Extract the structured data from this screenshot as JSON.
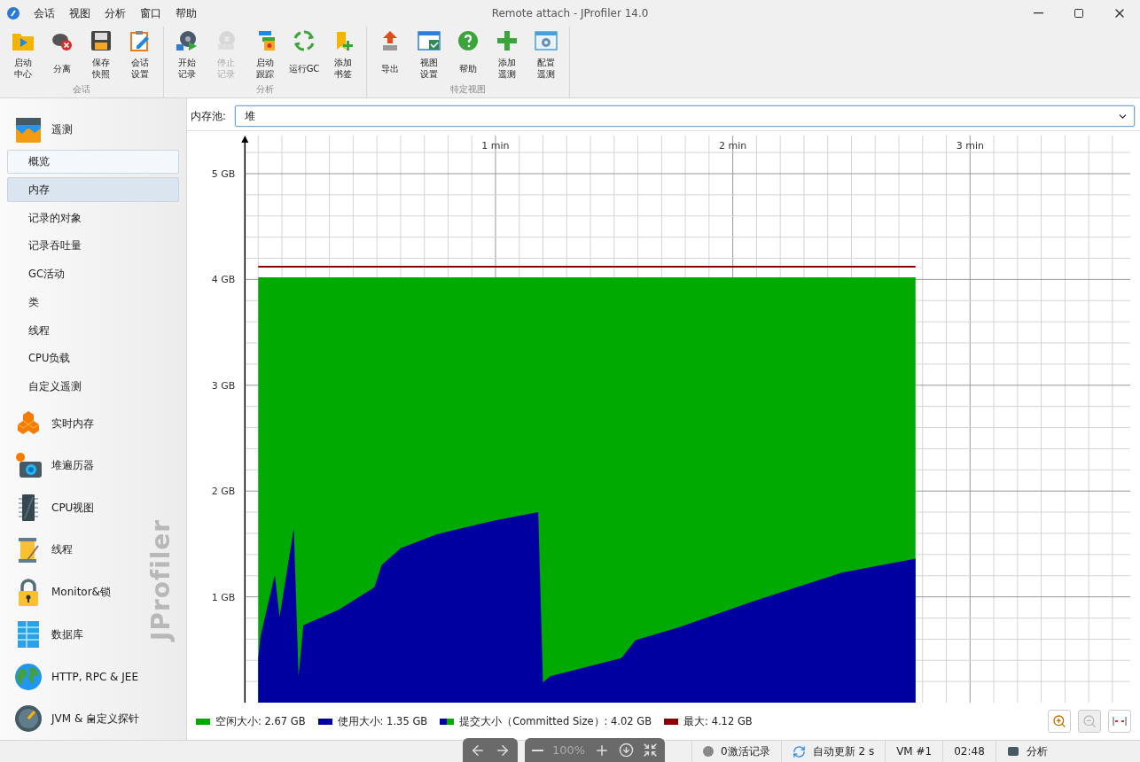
{
  "window": {
    "title": "Remote attach - JProfiler 14.0"
  },
  "menu": [
    "会话",
    "视图",
    "分析",
    "窗口",
    "帮助"
  ],
  "toolbar": {
    "groups": [
      {
        "label": "会话",
        "items": [
          {
            "lines": [
              "启动",
              "中心"
            ],
            "disabled": false
          },
          {
            "lines": [
              "分离"
            ],
            "disabled": false
          },
          {
            "lines": [
              "保存",
              "快照"
            ],
            "disabled": false
          },
          {
            "lines": [
              "会话",
              "设置"
            ],
            "disabled": false
          }
        ]
      },
      {
        "label": "分析",
        "items": [
          {
            "lines": [
              "开始",
              "记录"
            ],
            "disabled": false
          },
          {
            "lines": [
              "停止",
              "记录"
            ],
            "disabled": true
          },
          {
            "lines": [
              "启动",
              "跟踪"
            ],
            "disabled": false
          },
          {
            "lines": [
              "运行GC"
            ],
            "disabled": false
          },
          {
            "lines": [
              "添加",
              "书签"
            ],
            "disabled": false
          }
        ]
      },
      {
        "label": "特定视图",
        "items": [
          {
            "lines": [
              "导出"
            ],
            "disabled": false
          },
          {
            "lines": [
              "视图",
              "设置"
            ],
            "disabled": false
          },
          {
            "lines": [
              "帮助"
            ],
            "disabled": false
          },
          {
            "lines": [
              "添加",
              "遥测"
            ],
            "disabled": false
          },
          {
            "lines": [
              "配置",
              "遥测"
            ],
            "disabled": false
          }
        ]
      }
    ]
  },
  "sidebar": {
    "brand": "JProfiler",
    "items": [
      {
        "label": "遥测",
        "expanded": true,
        "children": [
          {
            "label": "概览",
            "selected": false,
            "focused": true
          },
          {
            "label": "内存",
            "selected": true,
            "focused": false
          },
          {
            "label": "记录的对象",
            "selected": false,
            "focused": false
          },
          {
            "label": "记录吞吐量",
            "selected": false,
            "focused": false
          },
          {
            "label": "GC活动",
            "selected": false,
            "focused": false
          },
          {
            "label": "类",
            "selected": false,
            "focused": false
          },
          {
            "label": "线程",
            "selected": false,
            "focused": false
          },
          {
            "label": "CPU负载",
            "selected": false,
            "focused": false
          },
          {
            "label": "自定义遥测",
            "selected": false,
            "focused": false
          }
        ]
      },
      {
        "label": "实时内存",
        "expanded": false
      },
      {
        "label": "堆遍历器",
        "expanded": false
      },
      {
        "label": "CPU视图",
        "expanded": false
      },
      {
        "label": "线程",
        "expanded": false
      },
      {
        "label": "Monitor&锁",
        "expanded": false
      },
      {
        "label": "数据库",
        "expanded": false
      },
      {
        "label": "HTTP, RPC & JEE",
        "expanded": false
      },
      {
        "label": "JVM & 自定义探针",
        "expanded": false
      }
    ]
  },
  "pool": {
    "label": "内存池:",
    "value": "堆"
  },
  "chart_data": {
    "type": "area",
    "grid": true,
    "xlim": [
      -0.3,
      3.69
    ],
    "ylim": [
      0,
      5.36
    ],
    "xticks": [
      {
        "value": 1,
        "label": "1 min"
      },
      {
        "value": 2,
        "label": "2 min"
      },
      {
        "value": 3,
        "label": "3 min"
      }
    ],
    "yticks": [
      {
        "value": 1,
        "label": "1 GB"
      },
      {
        "value": 2,
        "label": "2 GB"
      },
      {
        "value": 3,
        "label": "3 GB"
      },
      {
        "value": 4,
        "label": "4 GB"
      },
      {
        "value": 5,
        "label": "5 GB"
      }
    ],
    "x": [
      0,
      0.01,
      0.07,
      0.09,
      0.15,
      0.17,
      0.19,
      0.34,
      0.49,
      0.52,
      0.6,
      0.75,
      0.99,
      1.18,
      1.2,
      1.23,
      1.53,
      1.59,
      1.77,
      2.09,
      2.46,
      2.77
    ],
    "series": [
      {
        "color": "#00aa00",
        "type": "area",
        "values": [
          4.02,
          4.02,
          4.02,
          4.02,
          4.02,
          4.02,
          4.02,
          4.02,
          4.02,
          4.02,
          4.02,
          4.02,
          4.02,
          4.02,
          4.02,
          4.02,
          4.02,
          4.02,
          4.02,
          4.02,
          4.02,
          4.02
        ]
      },
      {
        "color": "#0000a0",
        "type": "area",
        "values": [
          0.42,
          0.63,
          1.21,
          0.81,
          1.65,
          0.25,
          0.73,
          0.88,
          1.09,
          1.3,
          1.46,
          1.59,
          1.72,
          1.8,
          0.19,
          0.25,
          0.42,
          0.59,
          0.71,
          0.96,
          1.23,
          1.36
        ]
      },
      {
        "color": "#8b0000",
        "type": "line",
        "values": [
          4.12,
          4.12,
          4.12,
          4.12,
          4.12,
          4.12,
          4.12,
          4.12,
          4.12,
          4.12,
          4.12,
          4.12,
          4.12,
          4.12,
          4.12,
          4.12,
          4.12,
          4.12,
          4.12,
          4.12,
          4.12,
          4.12
        ]
      }
    ]
  },
  "legend": [
    {
      "label": "空闲大小: 2.67 GB",
      "color": "#00aa00",
      "kind": "single"
    },
    {
      "label": "使用大小: 1.35 GB",
      "color": "#0000a0",
      "kind": "single"
    },
    {
      "label": "提交大小（Committed Size）: 4.02 GB",
      "color": "#00aa00",
      "kind": "split"
    },
    {
      "label": "最大: 4.12 GB",
      "color": "#8b0000",
      "kind": "single"
    }
  ],
  "zoom_buttons": [
    {
      "disabled": false
    },
    {
      "disabled": true
    },
    {
      "disabled": false
    }
  ],
  "overlay": {
    "zoom": "100%"
  },
  "status_bar": [
    "0激活记录",
    "自动更新 2 s",
    "VM #1",
    "02:48",
    "分析"
  ]
}
